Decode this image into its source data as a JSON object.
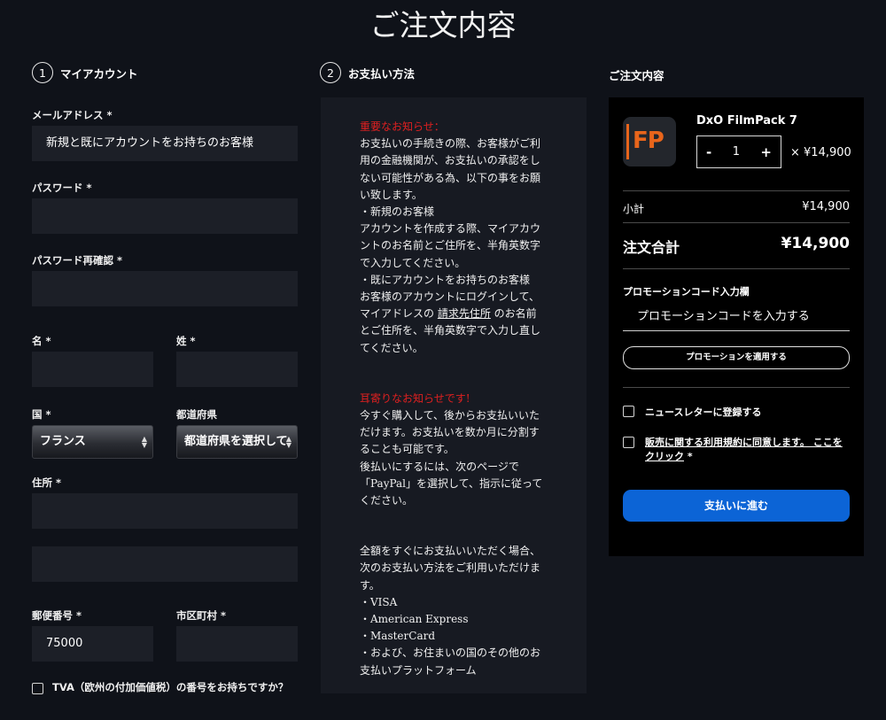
{
  "page": {
    "title": "ご注文内容"
  },
  "account": {
    "step": "1",
    "heading": "マイアカウント",
    "email_label": "メールアドレス *",
    "email_value": "新規と既にアカウントをお持ちのお客様",
    "password_label": "パスワード *",
    "password_confirm_label": "パスワード再確認 *",
    "first_name_label": "名 *",
    "last_name_label": "姓 *",
    "country_label": "国 *",
    "country_value": "フランス",
    "prefecture_label": "都道府県",
    "prefecture_value": "都道府県を選択して",
    "address_label": "住所 *",
    "postal_label": "郵便番号 *",
    "postal_value": "75000",
    "city_label": "市区町村 *",
    "tva_label": "TVA（欧州の付加価値税）の番号をお持ちですか？"
  },
  "payment": {
    "step": "2",
    "heading": "お支払い方法",
    "notice_title": "重要なお知らせ：",
    "notice_lines": [
      "お支払いの手続きの際、お客様がご利",
      "用の金融機関が、お支払いの承認をし",
      "ない可能性がある為、以下の事をお願",
      "い致します。",
      "・新規のお客様",
      "アカウントを作成する際、マイアカウ",
      "ントのお名前とご住所を、半角英数字",
      "で入力してください。",
      "・既にアカウントをお持ちのお客様",
      "お客様のアカウントにログインして、"
    ],
    "notice_line_pre": "マイアドレスの ",
    "notice_link": "請求先住所",
    "notice_line_post": " のお名前",
    "notice_lines2": [
      "とご住所を、半角英数字で入力し直し",
      "てください。"
    ],
    "info_title": "耳寄りなお知らせです!",
    "info_lines": [
      "今すぐ購入して、後からお支払いいた",
      "だけます。お支払いを数か月に分割す",
      "ることも可能です。",
      "後払いにするには、次のページで",
      "「PayPal」を選択して、指示に従って",
      "ください。"
    ],
    "methods_lines": [
      "全額をすぐにお支払いいただく場合、",
      "次のお支払い方法をご利用いただけま",
      "す。",
      "・VISA",
      "・American Express",
      "・MasterCard",
      "・および、お住まいの国のその他のお",
      "支払いプラットフォーム"
    ]
  },
  "summary": {
    "heading": "ご注文内容",
    "product_icon_text": "FP",
    "product_name": "DxO FilmPack 7",
    "qty_minus": "-",
    "quantity": "1",
    "qty_plus": "+",
    "unit_price": "× ¥14,900",
    "subtotal_label": "小計",
    "subtotal_value": "¥14,900",
    "total_label": "注文合計",
    "total_value": "¥14,900",
    "promo_label": "プロモーションコード入力欄",
    "promo_placeholder": "プロモーションコードを入力する",
    "promo_button": "プロモーションを適用する",
    "newsletter_label": "ニュースレターに登録する",
    "terms_label_part1": "販売に関する利用規約に同意します。 ここを",
    "terms_label_part2": "クリック",
    "terms_required": " *",
    "pay_button": "支払いに進む"
  },
  "colors": {
    "background": "#0f1219",
    "field": "#1c1f27",
    "panel": "#171a22",
    "summary_panel": "#000000",
    "accent_red": "#e02020",
    "pay_button": "#0c64d6",
    "brand_orange": "#e8651b"
  }
}
